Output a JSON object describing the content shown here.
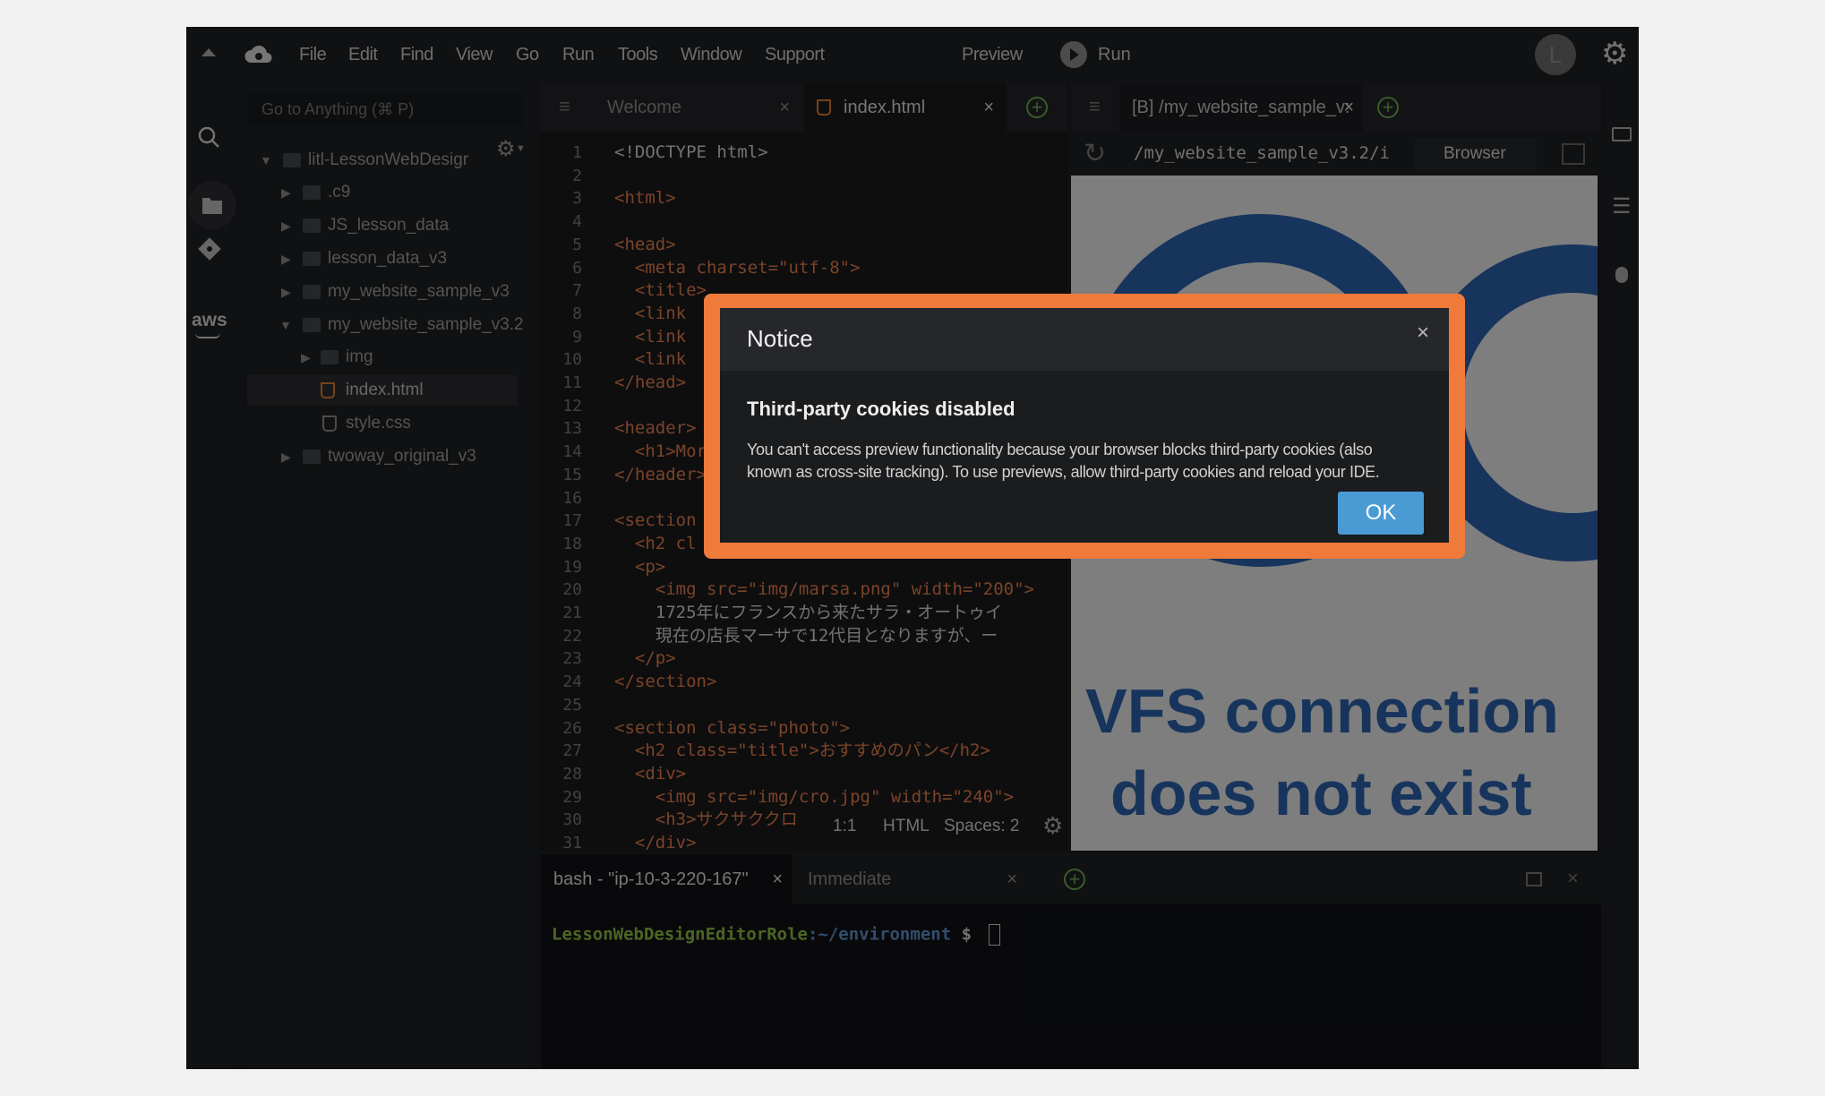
{
  "menu": {
    "items": [
      "File",
      "Edit",
      "Find",
      "View",
      "Go",
      "Run",
      "Tools",
      "Window",
      "Support"
    ],
    "preview_label": "Preview",
    "run_label": "Run",
    "avatar_letter": "L"
  },
  "sidebar": {
    "search_placeholder": "Go to Anything (⌘ P)",
    "aws_label": "aws",
    "tree": [
      {
        "label": "litl-LessonWebDesigr",
        "type": "folder",
        "expanded": true
      },
      {
        "label": ".c9",
        "type": "folder",
        "expanded": false
      },
      {
        "label": "JS_lesson_data",
        "type": "folder",
        "expanded": false
      },
      {
        "label": "lesson_data_v3",
        "type": "folder",
        "expanded": false
      },
      {
        "label": "my_website_sample_v3",
        "type": "folder",
        "expanded": false
      },
      {
        "label": "my_website_sample_v3.2",
        "type": "folder",
        "expanded": true
      },
      {
        "label": "img",
        "type": "folder",
        "expanded": false
      },
      {
        "label": "index.html",
        "type": "html-file",
        "selected": true
      },
      {
        "label": "style.css",
        "type": "css-file"
      },
      {
        "label": "twoway_original_v3",
        "type": "folder",
        "expanded": false
      }
    ]
  },
  "editor": {
    "tabs": [
      {
        "label": "Welcome",
        "active": false
      },
      {
        "label": "index.html",
        "active": true
      }
    ],
    "line_numbers": [
      "1",
      "2",
      "3",
      "4",
      "5",
      "6",
      "7",
      "8",
      "9",
      "10",
      "11",
      "12",
      "13",
      "14",
      "15",
      "16",
      "17",
      "18",
      "19",
      "20",
      "21",
      "22",
      "23",
      "24",
      "25",
      "26",
      "27",
      "28",
      "29",
      "30",
      "31"
    ],
    "lines": [
      "<!DOCTYPE html>",
      "",
      "<html>",
      "",
      "<head>",
      "  <meta charset=\"utf-8\">",
      "  <title>",
      "  <link",
      "  <link",
      "  <link",
      "</head>",
      "",
      "<header>",
      "  <h1>Mor",
      "</header>",
      "",
      "<section",
      "  <h2 cl",
      "  <p>",
      "    <img src=\"img/marsa.png\" width=\"200\">",
      "    1725年にフランスから来たサラ・オートゥイ",
      "    現在の店長マーサで12代目となりますが、ー",
      "  </p>",
      "</section>",
      "",
      "<section class=\"photo\">",
      "  <h2 class=\"title\">おすすめのパン</h2>",
      "  <div>",
      "    <img src=\"img/cro.jpg\" width=\"240\">",
      "    <h3>サクサククロ",
      "  </div>"
    ],
    "status": {
      "position": "1:1",
      "language": "HTML",
      "spaces": "Spaces: 2"
    }
  },
  "preview": {
    "tab_label": "[B] /my_website_sample_v:",
    "url": "/my_website_sample_v3.2/i",
    "browser_label": "Browser",
    "message_line1": "VFS connection",
    "message_line2": "does not exist"
  },
  "terminal": {
    "tabs": [
      {
        "label": "bash - \"ip-10-3-220-167\"",
        "active": true
      },
      {
        "label": "Immediate",
        "active": false
      }
    ],
    "prompt_role": "LessonWebDesignEditorRole",
    "prompt_path": ":~/environment",
    "prompt_symbol": " $"
  },
  "dialog": {
    "title": "Notice",
    "close": "×",
    "heading": "Third-party cookies disabled",
    "body_line1": "You can't access preview functionality because your browser blocks third-party cookies (also",
    "body_line2": "known as cross-site tracking). To use previews, allow third-party cookies and reload your IDE.",
    "ok_label": "OK"
  },
  "colors": {
    "highlight": "#f07a3a",
    "ok_button": "#4a9ad4",
    "preview_blue": "#2a5fa8"
  }
}
